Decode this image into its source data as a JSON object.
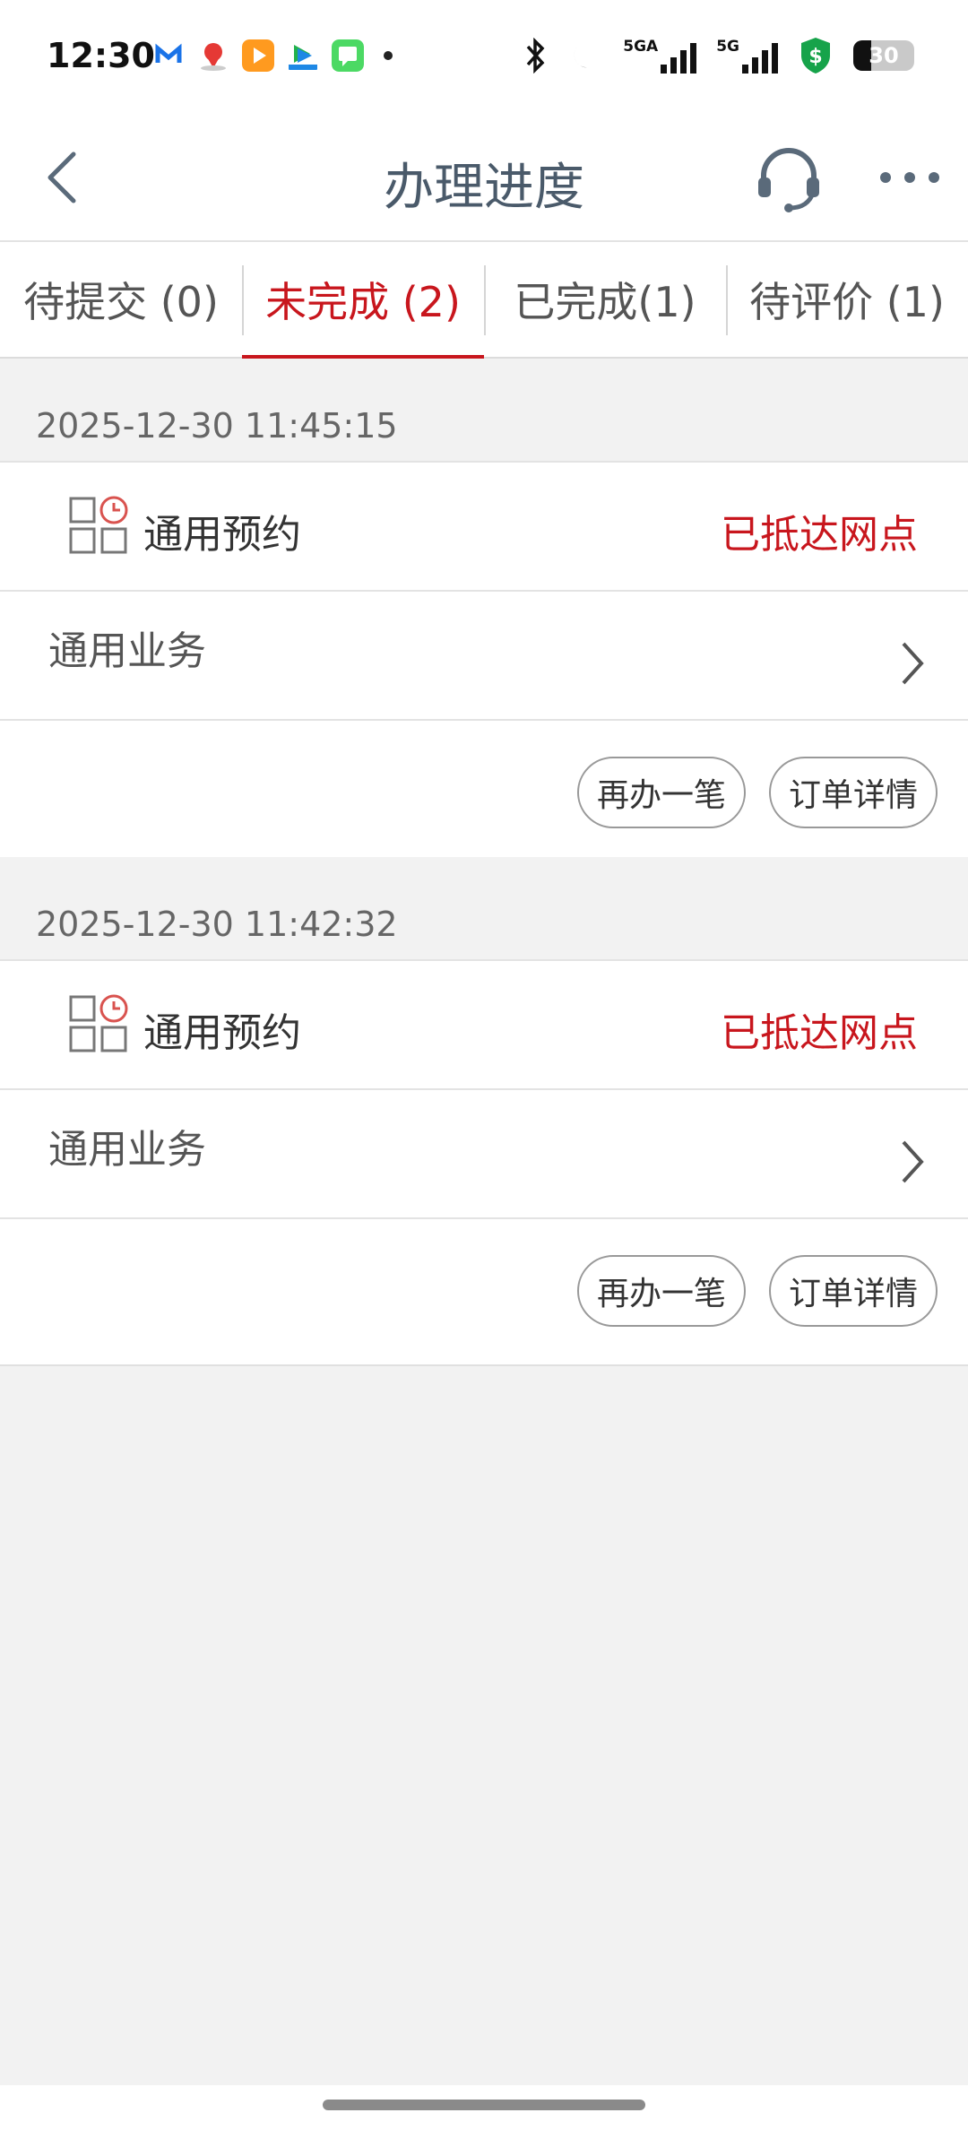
{
  "status_bar": {
    "time": "12:30",
    "signal1_label": "5GA",
    "signal2_label": "5G",
    "battery": "30"
  },
  "header": {
    "title": "办理进度"
  },
  "tabs": [
    {
      "label": "待提交 (0)",
      "active": false
    },
    {
      "label": "未完成 (2)",
      "active": true
    },
    {
      "label": "已完成(1)",
      "active": false
    },
    {
      "label": "待评价 (1)",
      "active": false
    }
  ],
  "orders": [
    {
      "timestamp": "2025-12-30 11:45:15",
      "service": "通用预约",
      "status": "已抵达网点",
      "business": "通用业务",
      "again_label": "再办一笔",
      "detail_label": "订单详情"
    },
    {
      "timestamp": "2025-12-30 11:42:32",
      "service": "通用预约",
      "status": "已抵达网点",
      "business": "通用业务",
      "again_label": "再办一笔",
      "detail_label": "订单详情"
    }
  ],
  "colors": {
    "accent": "#c8161d",
    "title": "#4a5a6a",
    "background": "#f2f2f2"
  }
}
